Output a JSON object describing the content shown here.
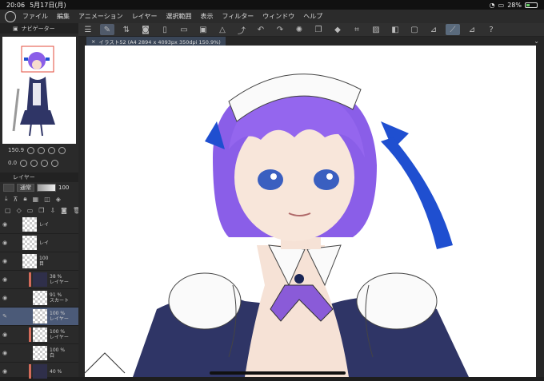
{
  "status": {
    "time": "20:06",
    "date": "5月17日(月)",
    "battery": "28%"
  },
  "menu": {
    "items": [
      "ファイル",
      "編集",
      "アニメーション",
      "レイヤー",
      "選択範囲",
      "表示",
      "フィルター",
      "ウィンドウ",
      "ヘルプ"
    ]
  },
  "navigator": {
    "title": "ナビゲーター",
    "zoom": "150.9",
    "rotate": "0.0"
  },
  "document": {
    "tab": "イラスト52 (A4 2894 x 4093px 350dpi 150.9%)"
  },
  "layers_panel": {
    "title": "レイヤー",
    "blend_mode": "通常",
    "opacity": "100",
    "layers": [
      {
        "pct": "",
        "name": "レイ",
        "clip": false,
        "dark": false,
        "indent": true
      },
      {
        "pct": "",
        "name": "レイ",
        "clip": false,
        "dark": false,
        "indent": true
      },
      {
        "pct": "100",
        "name": "目",
        "clip": false,
        "dark": false,
        "indent": true
      },
      {
        "pct": "38 %",
        "name": "レイヤー",
        "clip": true,
        "dark": true,
        "indent": false
      },
      {
        "pct": "91 %",
        "name": "スカート",
        "clip": false,
        "dark": false,
        "indent": false
      },
      {
        "pct": "100 %",
        "name": "レイヤー",
        "clip": false,
        "dark": false,
        "indent": false,
        "selected": true
      },
      {
        "pct": "100 %",
        "name": "レイヤー",
        "clip": true,
        "dark": false,
        "indent": false
      },
      {
        "pct": "100 %",
        "name": "白",
        "clip": false,
        "dark": false,
        "indent": false
      },
      {
        "pct": "40 %",
        "name": "",
        "clip": true,
        "dark": true,
        "indent": false
      }
    ]
  },
  "colors": {
    "hair": "#8a5ee8",
    "ribbon": "#1f4fd0",
    "tie": "#8a5bd8",
    "dress": "#2f3566",
    "selection": "#4b5a78"
  }
}
